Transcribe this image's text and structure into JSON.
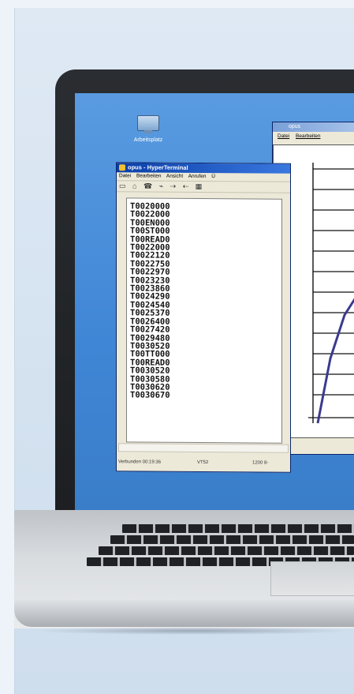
{
  "desktop": {
    "icon_label": "Arbeitsplatz",
    "icon": "computer-icon"
  },
  "hyperterminal": {
    "title": "opus - HyperTerminal",
    "menu": [
      "Datei",
      "Bearbeiten",
      "Ansicht",
      "Anrufen",
      "Ü"
    ],
    "toolbar_icons": [
      "new-icon",
      "open-icon",
      "disconnect-icon",
      "call-icon",
      "send-icon",
      "receive-icon",
      "properties-icon"
    ],
    "terminal_lines": [
      "T0020000",
      "T0022000",
      "T00EN000",
      "T00ST000",
      "T00READ0",
      "T0022000",
      "T0022120",
      "T0022750",
      "T0022970",
      "T0023230",
      "T0023860",
      "T0024290",
      "T0024540",
      "T0025370",
      "T0026400",
      "T0027420",
      "T0029480",
      "T0030520",
      "T00TT000",
      "T00READ0",
      "T0030520",
      "T0030580",
      "T0030620",
      "T0030670"
    ],
    "status": {
      "connected": "Verbunden 00:19:36",
      "terminal": "VT52",
      "baud": "1200 8-"
    }
  },
  "opus_window": {
    "title": "opus",
    "menu": [
      "Datei",
      "Bearbeiten"
    ]
  },
  "colors": {
    "desktop_blue": "#4a8fdc",
    "plot_line": "#3b3a8f",
    "titlebar": "#0a3ea8"
  }
}
